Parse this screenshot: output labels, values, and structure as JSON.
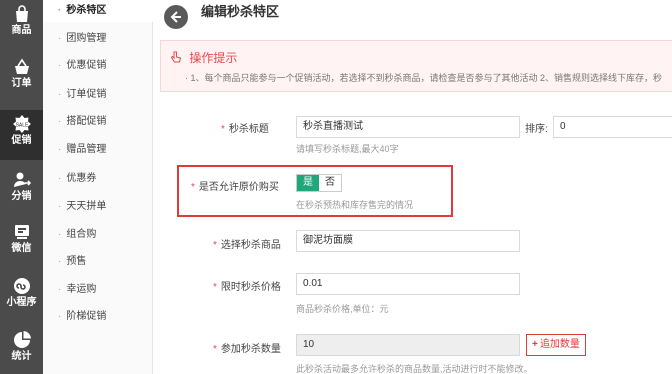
{
  "sidebar": {
    "items": [
      {
        "label": "商品",
        "icon": "shopping-bag-icon"
      },
      {
        "label": "订单",
        "icon": "basket-icon"
      },
      {
        "label": "促销",
        "icon": "promo-badge-icon"
      },
      {
        "label": "分销",
        "icon": "distribution-icon"
      },
      {
        "label": "微信",
        "icon": "wechat-icon"
      },
      {
        "label": "小程序",
        "icon": "mini-program-icon"
      },
      {
        "label": "统计",
        "icon": "pie-chart-icon"
      }
    ],
    "active_index": 2
  },
  "submenu": {
    "items": [
      "秒杀特区",
      "团购管理",
      "优惠促销",
      "订单促销",
      "搭配促销",
      "赠品管理",
      "优惠券",
      "天天拼单",
      "组合购",
      "预售",
      "幸运购",
      "阶梯促销"
    ],
    "active_index": 0
  },
  "header": {
    "title": "编辑秒杀特区"
  },
  "tips": {
    "title": "操作提示",
    "text": "· 1、每个商品只能参与一个促销活动，若选择不到秒杀商品，请检查是否参与了其他活动 2、销售规则选择线下库存，秒"
  },
  "form": {
    "title_label": "秒杀标题",
    "title_value": "秒杀直播测试",
    "title_hint": "请填写秒杀标题,最大40字",
    "sort_label": "排序:",
    "sort_value": "0",
    "allow_label": "是否允许原价购买",
    "allow_yes": "是",
    "allow_no": "否",
    "allow_hint": "在秒杀预热和库存售完的情况",
    "product_label": "选择秒杀商品",
    "product_value": "御泥坊面膜",
    "price_label": "限时秒杀价格",
    "price_value": "0.01",
    "price_hint": "商品秒杀价格,单位：元",
    "qty_label": "参加秒杀数量",
    "qty_value": "10",
    "qty_add": "追加数量",
    "qty_hint": "此秒杀活动最多允许秒杀的商品数量,活动进行时不能修改。"
  },
  "colors": {
    "accent": "#e84a4a",
    "toggle_on": "#1fa67a",
    "sidebar_bg": "#4b4b4b"
  }
}
